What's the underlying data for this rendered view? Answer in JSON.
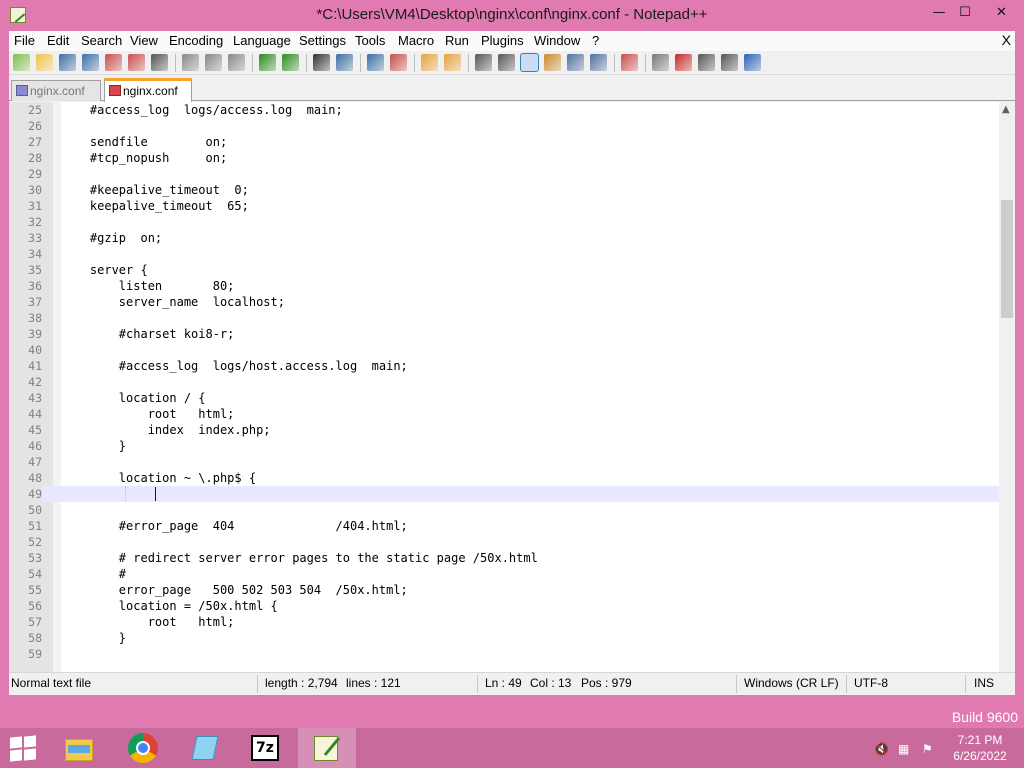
{
  "window": {
    "title": "*C:\\Users\\VM4\\Desktop\\nginx\\conf\\nginx.conf - Notepad++",
    "minimize": "—",
    "maximize": "☐",
    "close": "✕"
  },
  "menu": {
    "items": [
      "File",
      "Edit",
      "Search",
      "View",
      "Encoding",
      "Language",
      "Settings",
      "Tools",
      "Macro",
      "Run",
      "Plugins",
      "Window",
      "?"
    ],
    "close": "X"
  },
  "toolbar": {
    "buttons": [
      "new-file-icon",
      "open-file-icon",
      "save-icon",
      "save-all-icon",
      "close-icon",
      "close-all-icon",
      "print-icon",
      "cut-icon",
      "copy-icon",
      "paste-icon",
      "undo-icon",
      "redo-icon",
      "find-icon",
      "replace-icon",
      "zoom-in-icon",
      "zoom-out-icon",
      "sync-vertical-icon",
      "sync-horizontal-icon",
      "word-wrap-icon",
      "show-all-chars-icon",
      "indent-guide-icon",
      "user-language-icon",
      "document-map-icon",
      "function-list-icon",
      "folder-as-workspace-icon",
      "monitoring-icon",
      "record-macro-icon",
      "stop-record-icon",
      "play-macro-icon",
      "run-multiple-macro-icon",
      "save-macro-icon"
    ]
  },
  "tabs": [
    {
      "label": "nginx.conf",
      "active": false
    },
    {
      "label": "nginx.conf",
      "active": true
    }
  ],
  "editor": {
    "current_line": 49,
    "lines": [
      {
        "n": "25",
        "text": "    #access_log  logs/access.log  main;"
      },
      {
        "n": "26",
        "text": ""
      },
      {
        "n": "27",
        "text": "    sendfile        on;"
      },
      {
        "n": "28",
        "text": "    #tcp_nopush     on;"
      },
      {
        "n": "29",
        "text": ""
      },
      {
        "n": "30",
        "text": "    #keepalive_timeout  0;"
      },
      {
        "n": "31",
        "text": "    keepalive_timeout  65;"
      },
      {
        "n": "32",
        "text": ""
      },
      {
        "n": "33",
        "text": "    #gzip  on;"
      },
      {
        "n": "34",
        "text": ""
      },
      {
        "n": "35",
        "text": "    server {"
      },
      {
        "n": "36",
        "text": "        listen       80;"
      },
      {
        "n": "37",
        "text": "        server_name  localhost;"
      },
      {
        "n": "38",
        "text": ""
      },
      {
        "n": "39",
        "text": "        #charset koi8-r;"
      },
      {
        "n": "40",
        "text": ""
      },
      {
        "n": "41",
        "text": "        #access_log  logs/host.access.log  main;"
      },
      {
        "n": "42",
        "text": ""
      },
      {
        "n": "43",
        "text": "        location / {"
      },
      {
        "n": "44",
        "text": "            root   html;"
      },
      {
        "n": "45",
        "text": "            index  index.php;"
      },
      {
        "n": "46",
        "text": "        }"
      },
      {
        "n": "47",
        "text": ""
      },
      {
        "n": "48",
        "text": "        location ~ \\.php$ {"
      },
      {
        "n": "49",
        "text": "            "
      },
      {
        "n": "50",
        "text": ""
      },
      {
        "n": "51",
        "text": "        #error_page  404              /404.html;"
      },
      {
        "n": "52",
        "text": ""
      },
      {
        "n": "53",
        "text": "        # redirect server error pages to the static page /50x.html"
      },
      {
        "n": "54",
        "text": "        #"
      },
      {
        "n": "55",
        "text": "        error_page   500 502 503 504  /50x.html;"
      },
      {
        "n": "56",
        "text": "        location = /50x.html {"
      },
      {
        "n": "57",
        "text": "            root   html;"
      },
      {
        "n": "58",
        "text": "        }"
      },
      {
        "n": "59",
        "text": ""
      }
    ]
  },
  "status": {
    "file_type": "Normal text file",
    "length": "length : 2,794",
    "lines": "lines : 121",
    "ln": "Ln : 49",
    "col": "Col : 13",
    "pos": "Pos : 979",
    "eol": "Windows (CR LF)",
    "encoding": "UTF-8",
    "mode": "INS"
  },
  "desktop": {
    "build": "Build 9600"
  },
  "taskbar": {
    "apps": [
      "file-explorer-icon",
      "chrome-icon",
      "notepad-icon",
      "7zip-icon",
      "notepad-plus-plus-icon"
    ],
    "seven_zip_label": "7z",
    "time": "7:21 PM",
    "date": "6/26/2022"
  },
  "colors": {
    "accent": "#e07ab0",
    "taskbar": "#c96a9c",
    "current_line": "#e8e8ff",
    "caret": "#0000ff"
  }
}
